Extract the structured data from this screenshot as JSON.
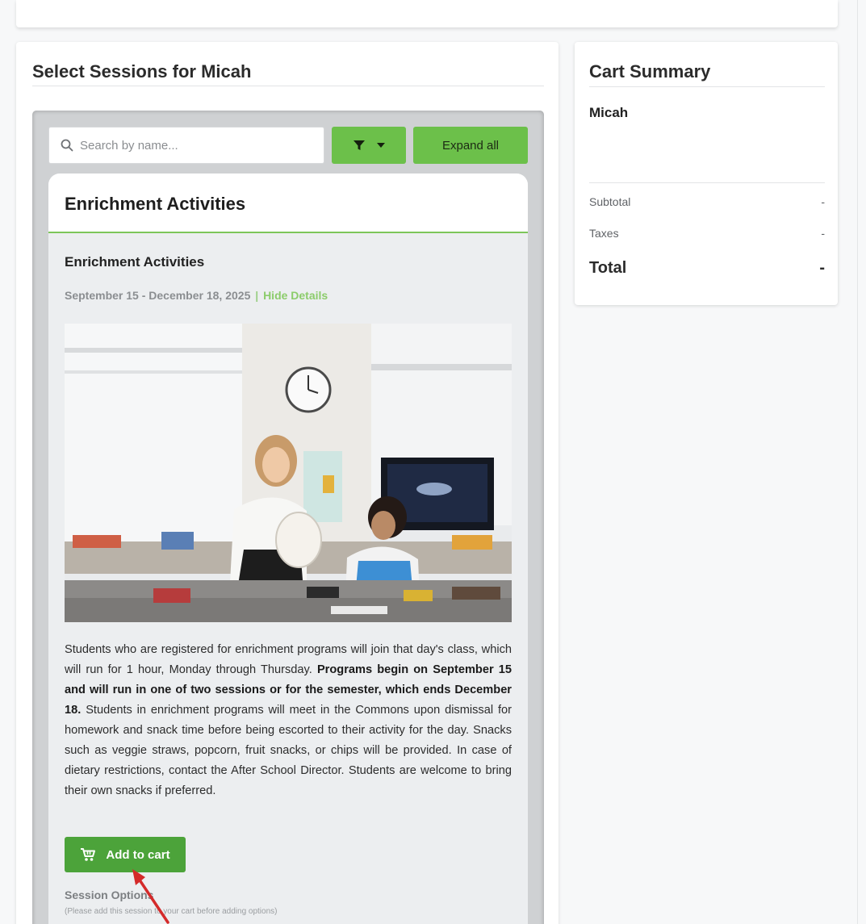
{
  "sessions": {
    "heading": "Select Sessions for Micah",
    "search_placeholder": "Search by name...",
    "expand_all_label": "Expand all",
    "category": {
      "title": "Enrichment Activities",
      "program_title": "Enrichment Activities",
      "date_range": "September 15 - December 18, 2025",
      "date_separator": "|",
      "hide_details_label": "Hide Details",
      "description_intro": "Students who are registered for enrichment programs will join that day's class, which will run for 1 hour, Monday through Thursday.",
      "description_bold": "Programs begin on September 15 and will run in one of two sessions or for the semester, which ends December 18.",
      "description_rest": "Students in enrichment programs will meet in the Commons upon dismissal for homework and snack time before being escorted to their activity for the day. Snacks such as veggie straws, popcorn, fruit snacks, or chips will be provided. In case of dietary restrictions, contact the After School Director. Students are welcome to bring their own snacks if preferred.",
      "add_to_cart_label": "Add to cart",
      "session_options_label": "Session Options",
      "session_options_note": "(Please add this session to your cart before adding options)"
    }
  },
  "cart": {
    "title": "Cart Summary",
    "student": "Micah",
    "subtotal_label": "Subtotal",
    "subtotal_value": "-",
    "taxes_label": "Taxes",
    "taxes_value": "-",
    "total_label": "Total",
    "total_value": "-"
  },
  "icons": {
    "search": "search-icon",
    "filter": "filter-icon",
    "dropdown": "caret-down-icon",
    "cart": "cart-icon",
    "annotation": "red-arrow-icon"
  },
  "colors": {
    "accent_green": "#6cc04a",
    "button_green": "#4ca33a",
    "link_green": "#8ccc6b",
    "annotation_red": "#d42a2a"
  }
}
